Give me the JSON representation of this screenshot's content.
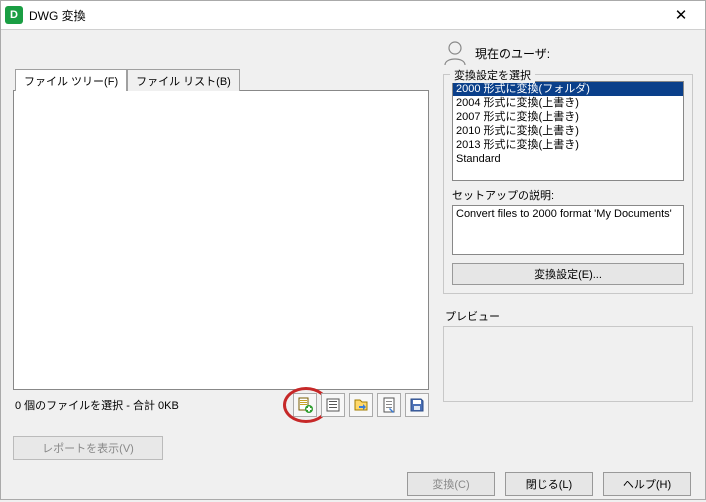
{
  "window": {
    "title": "DWG 変換",
    "app_icon_letter": "D"
  },
  "user": {
    "label": "現在のユーザ:",
    "name": ""
  },
  "tabs": {
    "file_tree": "ファイル ツリー(F)",
    "file_list": "ファイル リスト(B)"
  },
  "status": {
    "text": "0 個のファイルを選択 - 合計 0KB"
  },
  "buttons": {
    "report": "レポートを表示(V)",
    "convert": "変換(C)",
    "close": "閉じる(L)",
    "help": "ヘルプ(H)",
    "convert_settings": "変換設定(E)..."
  },
  "settings": {
    "group_title": "変換設定を選択",
    "items": [
      "2000 形式に変換(フォルダ)",
      "2004 形式に変換(上書き)",
      "2007 形式に変換(上書き)",
      "2010 形式に変換(上書き)",
      "2013 形式に変換(上書き)",
      "Standard"
    ],
    "selected_index": 0,
    "desc_label": "セットアップの説明:",
    "desc_text": "Convert files to 2000 format 'My Documents'"
  },
  "preview": {
    "label": "プレビュー"
  },
  "icons": {
    "add_file": "add-file-icon",
    "list": "list-icon",
    "export": "export-icon",
    "sheet": "sheet-icon",
    "save": "save-icon"
  }
}
